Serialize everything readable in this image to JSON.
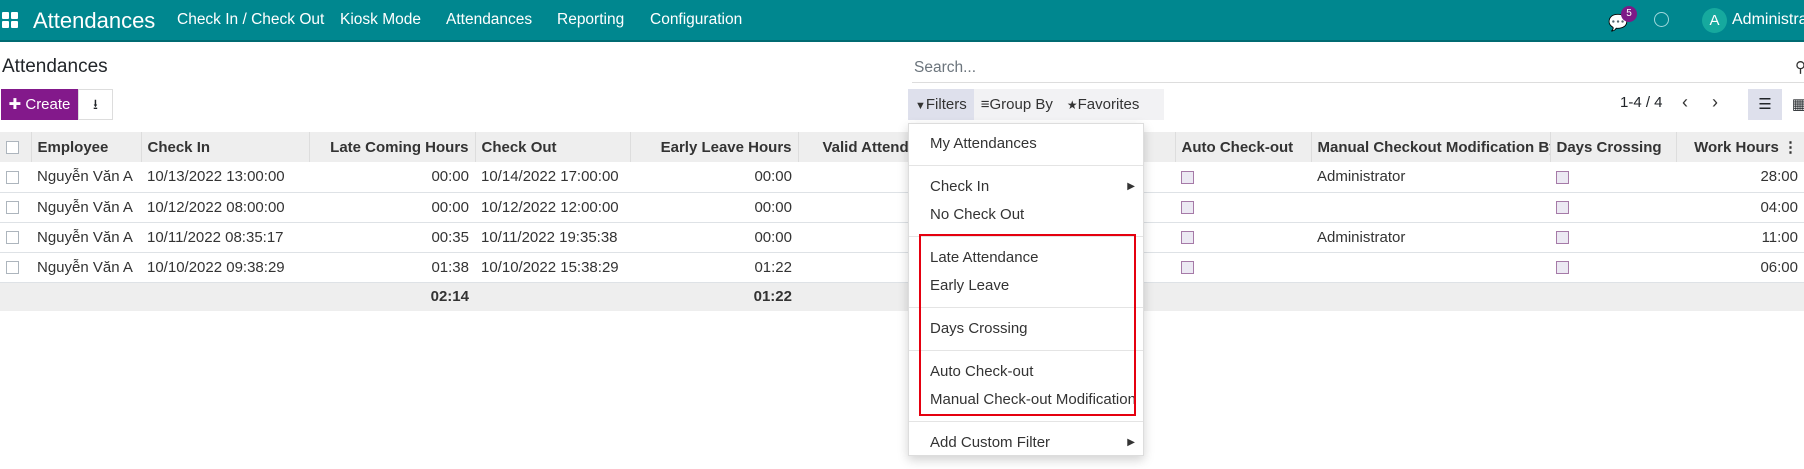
{
  "nav": {
    "brand": "Attendances",
    "menus": [
      "Check In / Check Out",
      "Kiosk Mode",
      "Attendances",
      "Reporting",
      "Configuration"
    ],
    "message_count": "5",
    "avatar_letter": "A",
    "user": "Administrator",
    "color": "#00878f"
  },
  "page": {
    "title": "Attendances",
    "create_label": "Create",
    "search_placeholder": "Search..."
  },
  "filters": {
    "filters_label": "Filters",
    "groupby_label": "Group By",
    "favorites_label": "Favorites"
  },
  "pager": {
    "text": "1-4 / 4"
  },
  "table": {
    "columns": [
      "Employee",
      "Check In",
      "Late Coming Hours",
      "Check Out",
      "Early Leave Hours",
      "Valid Attendance",
      "Auto Check-out",
      "Manual Checkout Modification By",
      "Days Crossing",
      "Work Hours"
    ],
    "rows": [
      {
        "employee": "Nguyễn Văn A",
        "check_in": "10/13/2022 13:00:00",
        "late": "00:00",
        "check_out": "10/14/2022 17:00:00",
        "early": "00:00",
        "auto": false,
        "manual_by": "Administrator",
        "days_crossing": false,
        "work_hours": "28:00"
      },
      {
        "employee": "Nguyễn Văn A",
        "check_in": "10/12/2022 08:00:00",
        "late": "00:00",
        "check_out": "10/12/2022 12:00:00",
        "early": "00:00",
        "auto": false,
        "manual_by": "",
        "days_crossing": false,
        "work_hours": "04:00"
      },
      {
        "employee": "Nguyễn Văn A",
        "check_in": "10/11/2022 08:35:17",
        "late": "00:35",
        "check_out": "10/11/2022 19:35:38",
        "early": "00:00",
        "auto": false,
        "manual_by": "Administrator",
        "days_crossing": false,
        "work_hours": "11:00"
      },
      {
        "employee": "Nguyễn Văn A",
        "check_in": "10/10/2022 09:38:29",
        "late": "01:38",
        "check_out": "10/10/2022 15:38:29",
        "early": "01:22",
        "auto": false,
        "manual_by": "",
        "days_crossing": false,
        "work_hours": "06:00"
      }
    ],
    "totals": {
      "late": "02:14",
      "early": "01:22"
    }
  },
  "dropdown": {
    "items": [
      "My Attendances",
      "Check In",
      "No Check Out",
      "Late Attendance",
      "Early Leave",
      "Days Crossing",
      "Auto Check-out",
      "Manual Check-out Modification",
      "Add Custom Filter"
    ],
    "highlight_color": "#e5000f"
  }
}
